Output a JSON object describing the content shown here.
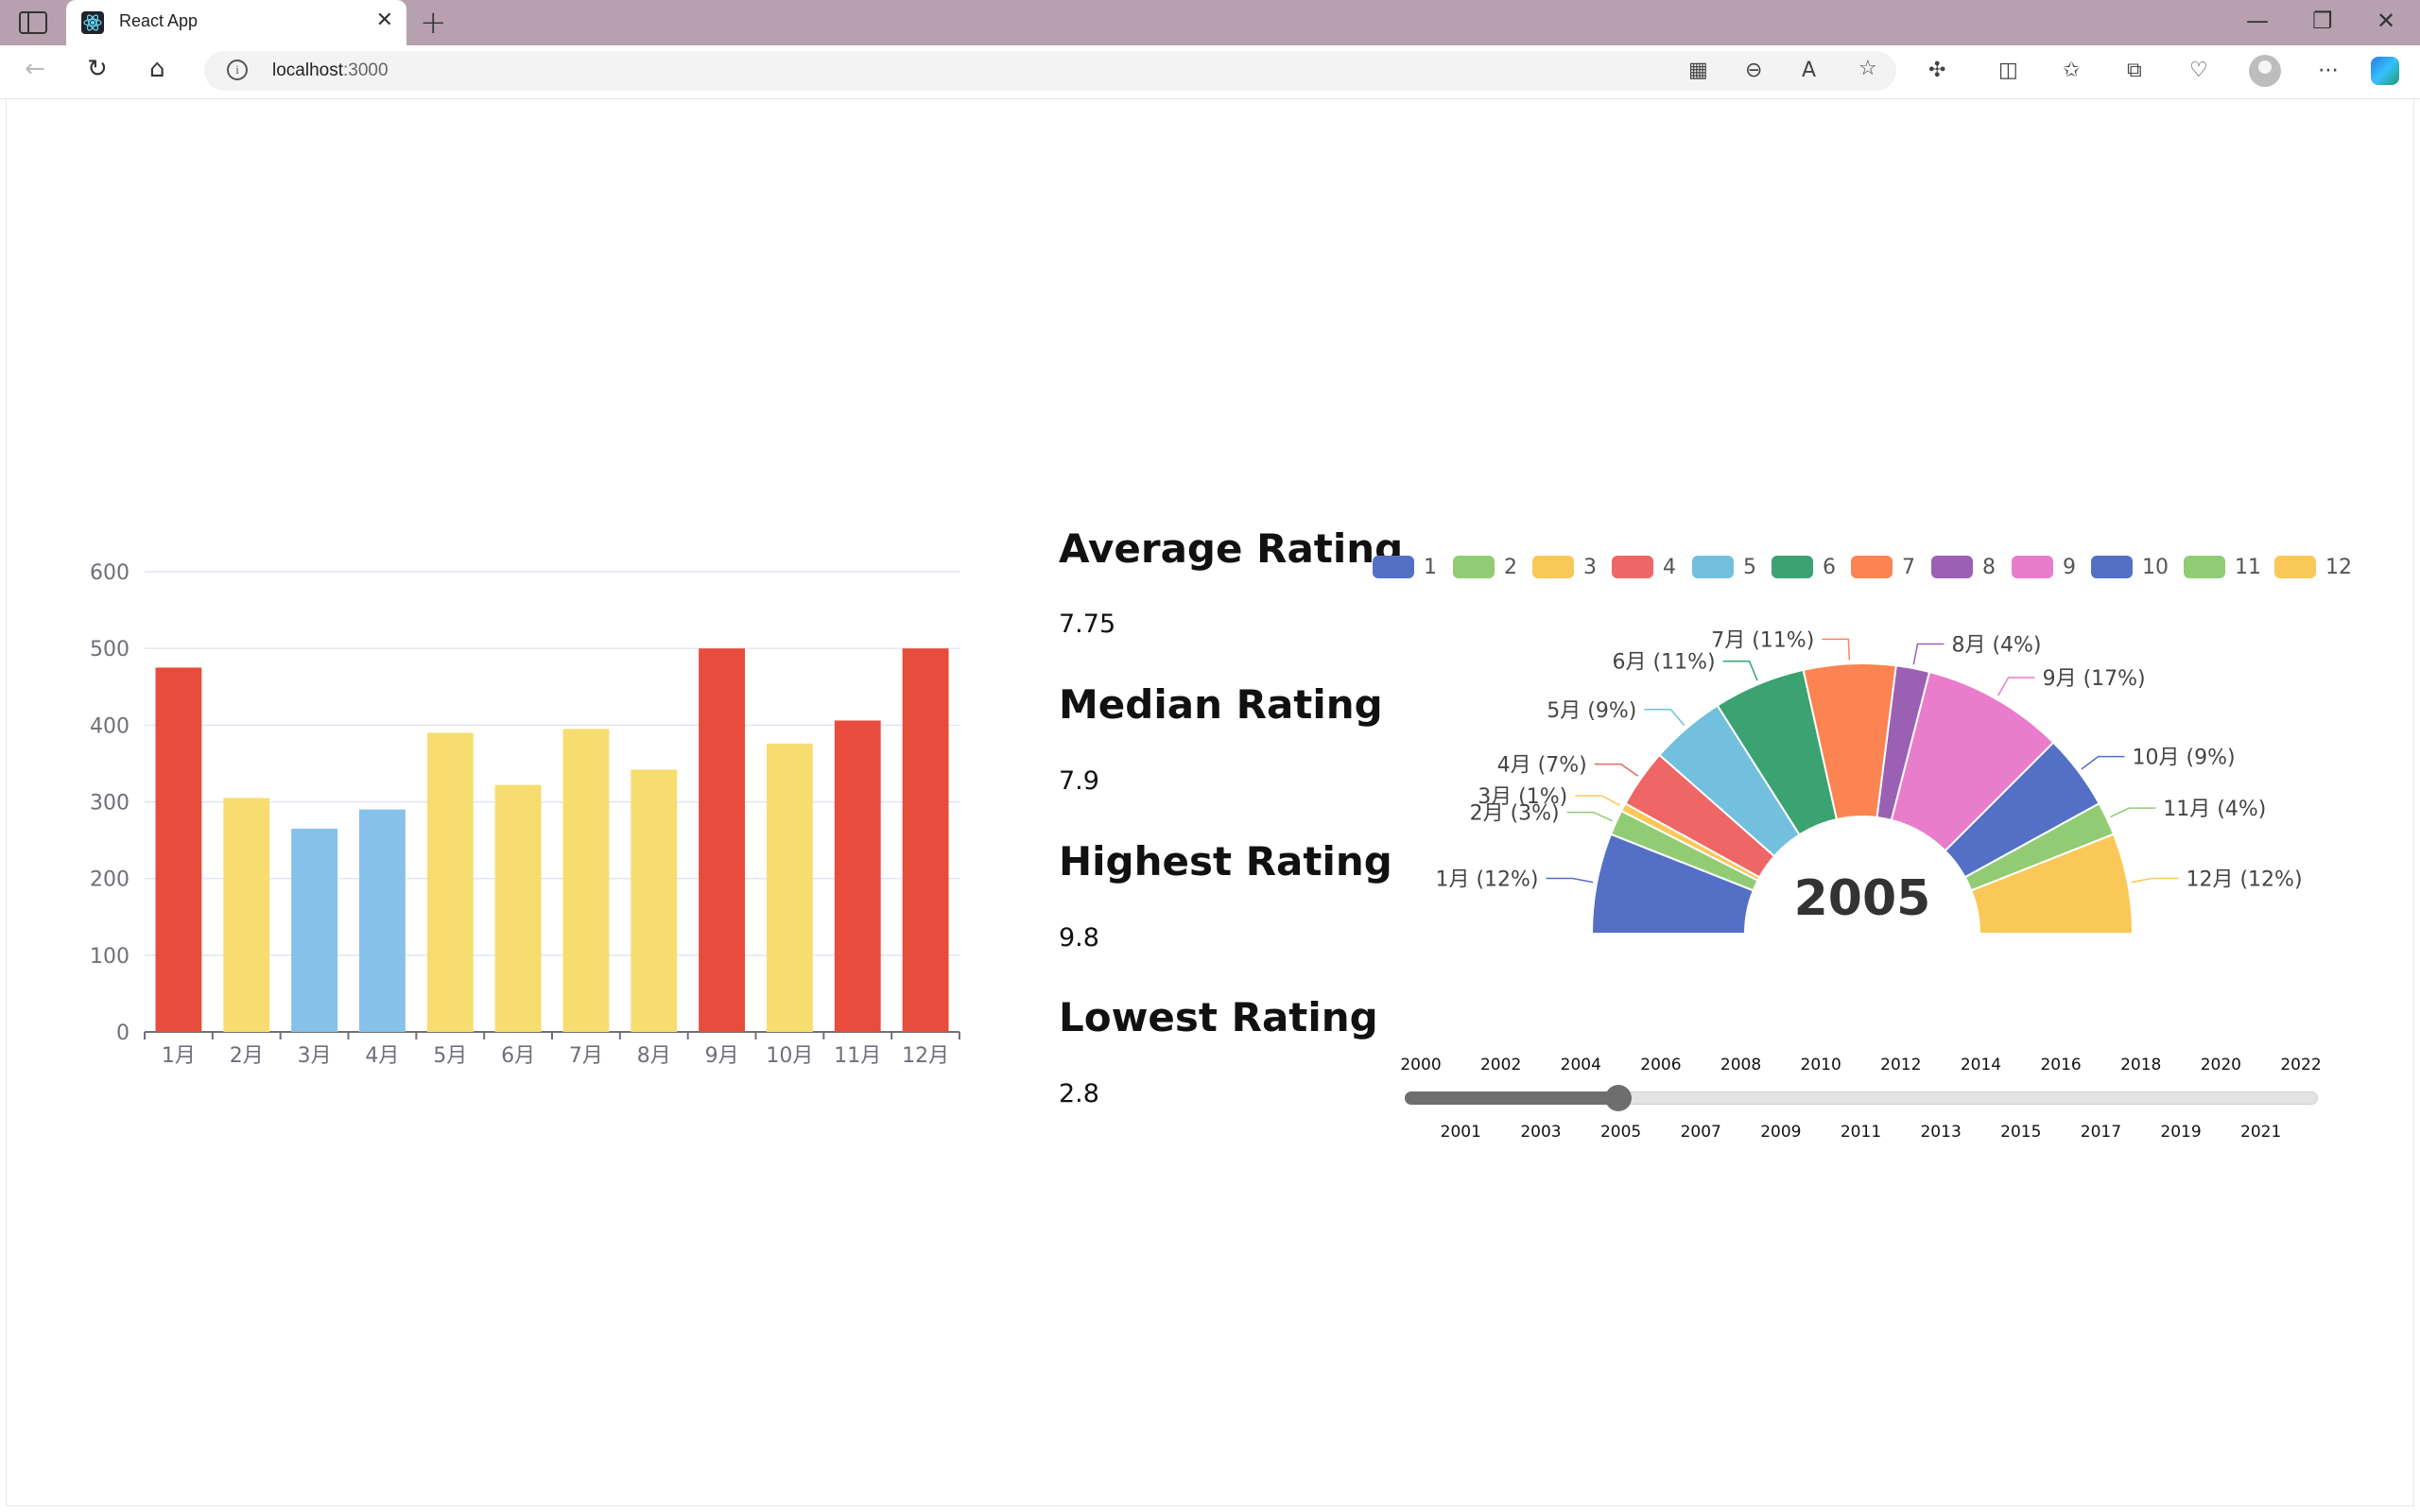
{
  "browser": {
    "tab_title": "React App",
    "url_host": "localhost",
    "url_port": ":3000"
  },
  "stats": [
    {
      "title": "Average Rating",
      "value": "7.75"
    },
    {
      "title": "Median Rating",
      "value": "7.9"
    },
    {
      "title": "Highest Rating",
      "value": "9.8"
    },
    {
      "title": "Lowest Rating",
      "value": "2.8"
    }
  ],
  "slider": {
    "min": 2000,
    "max": 2022,
    "value": 2005,
    "top_labels": [
      "2000",
      "2002",
      "2004",
      "2006",
      "2008",
      "2010",
      "2012",
      "2014",
      "2016",
      "2018",
      "2020",
      "2022"
    ],
    "bottom_labels": [
      "2001",
      "2003",
      "2005",
      "2007",
      "2009",
      "2011",
      "2013",
      "2015",
      "2017",
      "2019",
      "2021"
    ]
  },
  "colors": {
    "bar_red": "#e74c3c",
    "bar_yellow": "#f7dc6f",
    "bar_blue": "#85c1e9",
    "pie": [
      "#5470c6",
      "#91cc75",
      "#fac858",
      "#ee6666",
      "#73c0de",
      "#3ba272",
      "#fc8452",
      "#9a60b4",
      "#ea7ccc",
      "#5470c6",
      "#91cc75",
      "#fac858"
    ]
  },
  "chart_data": [
    {
      "type": "bar",
      "categories": [
        "1月",
        "2月",
        "3月",
        "4月",
        "5月",
        "6月",
        "7月",
        "8月",
        "9月",
        "10月",
        "11月",
        "12月"
      ],
      "values": [
        475,
        305,
        265,
        290,
        390,
        322,
        395,
        342,
        500,
        376,
        406,
        500
      ],
      "bar_colors": [
        "red",
        "yellow",
        "blue",
        "blue",
        "yellow",
        "yellow",
        "yellow",
        "yellow",
        "red",
        "yellow",
        "red",
        "red"
      ],
      "ylim": [
        0,
        600
      ],
      "yticks": [
        0,
        100,
        200,
        300,
        400,
        500,
        600
      ],
      "grid": true
    },
    {
      "type": "pie",
      "subtype": "half-donut",
      "center_label": "2005",
      "legend": [
        "1",
        "2",
        "3",
        "4",
        "5",
        "6",
        "7",
        "8",
        "9",
        "10",
        "11",
        "12"
      ],
      "legend_position": "top",
      "slices": [
        {
          "label": "1月 (12%)",
          "value": 12
        },
        {
          "label": "2月 (3%)",
          "value": 3
        },
        {
          "label": "3月 (1%)",
          "value": 1
        },
        {
          "label": "4月 (7%)",
          "value": 7
        },
        {
          "label": "5月 (9%)",
          "value": 9
        },
        {
          "label": "6月 (11%)",
          "value": 11
        },
        {
          "label": "7月 (11%)",
          "value": 11
        },
        {
          "label": "8月 (4%)",
          "value": 4
        },
        {
          "label": "9月 (17%)",
          "value": 17
        },
        {
          "label": "10月 (9%)",
          "value": 9
        },
        {
          "label": "11月 (4%)",
          "value": 4
        },
        {
          "label": "12月 (12%)",
          "value": 12
        }
      ]
    }
  ]
}
